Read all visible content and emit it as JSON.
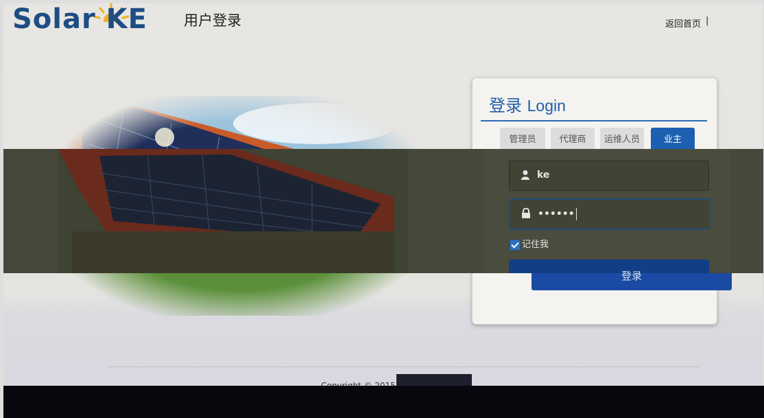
{
  "header": {
    "logo_text": "Solar KE",
    "page_heading": "用户登录",
    "home_link": "返回首页",
    "separator": "|"
  },
  "login": {
    "title_zh": "登录",
    "title_en": "Login",
    "tabs": [
      {
        "label": "管理员",
        "active": false
      },
      {
        "label": "代理商",
        "active": false
      },
      {
        "label": "运维人员",
        "active": false
      },
      {
        "label": "业主",
        "active": true
      }
    ],
    "username": {
      "value": "ke",
      "icon": "user-icon"
    },
    "password": {
      "value": "••••••",
      "icon": "lock-icon"
    },
    "remember_label": "记住我",
    "remember_checked": true,
    "submit_label": "登录"
  },
  "footer": {
    "copyright": "Copyright © 2015"
  },
  "colors": {
    "brand": "#1d4d83",
    "accent": "#1d5fb0"
  }
}
